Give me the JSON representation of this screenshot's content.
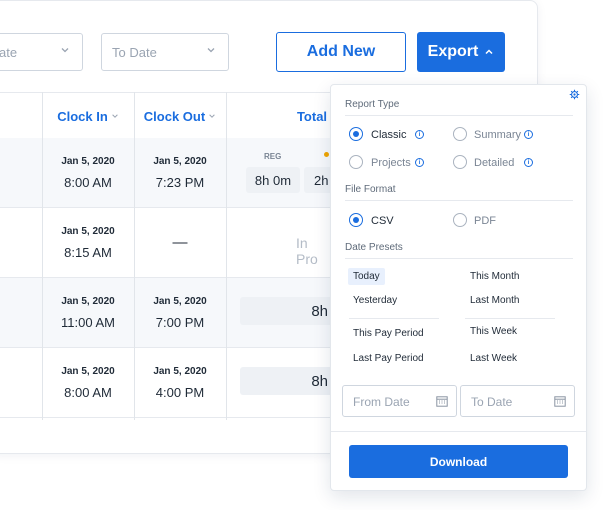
{
  "toolbar": {
    "from_date_placeholder": "ate",
    "to_date_placeholder": "To Date",
    "add_new_label": "Add New",
    "export_label": "Export"
  },
  "table": {
    "columns": [
      "Clock In",
      "Clock Out",
      "Total"
    ],
    "reg_label": "REG",
    "rows": [
      {
        "in_date": "Jan 5, 2020",
        "in_time": "8:00 AM",
        "out_date": "Jan 5, 2020",
        "out_time": "7:23 PM",
        "reg": "8h 0m",
        "extra": "2h"
      },
      {
        "in_date": "Jan 5, 2020",
        "in_time": "8:15 AM",
        "out_dash": "—",
        "status": "In Pro"
      },
      {
        "in_date": "Jan 5, 2020",
        "in_time": "11:00 AM",
        "out_date": "Jan 5, 2020",
        "out_time": "7:00 PM",
        "total": "8h"
      },
      {
        "in_date": "Jan 5, 2020",
        "in_time": "8:00 AM",
        "out_date": "Jan 5, 2020",
        "out_time": "4:00 PM",
        "total": "8h"
      }
    ]
  },
  "export_panel": {
    "report_type_label": "Report Type",
    "report_types": [
      {
        "label": "Classic",
        "selected": true
      },
      {
        "label": "Summary",
        "selected": false
      },
      {
        "label": "Projects",
        "selected": false
      },
      {
        "label": "Detailed",
        "selected": false
      }
    ],
    "file_format_label": "File Format",
    "file_formats": [
      {
        "label": "CSV",
        "selected": true
      },
      {
        "label": "PDF",
        "selected": false
      }
    ],
    "date_presets_label": "Date Presets",
    "presets_left": [
      "Today",
      "Yesterday",
      "This Pay Period",
      "Last Pay Period"
    ],
    "presets_right": [
      "This Month",
      "Last Month",
      "This Week",
      "Last Week"
    ],
    "selected_preset": "Today",
    "from_date_placeholder": "From Date",
    "to_date_placeholder": "To Date",
    "download_label": "Download"
  },
  "colors": {
    "accent": "#1a6ddf",
    "highlight": "#e8f0fd",
    "warning_dot": "#f0a500"
  },
  "icons": [
    "chevron-down-icon",
    "chevron-up-icon",
    "gear-icon",
    "info-icon",
    "calendar-icon"
  ]
}
